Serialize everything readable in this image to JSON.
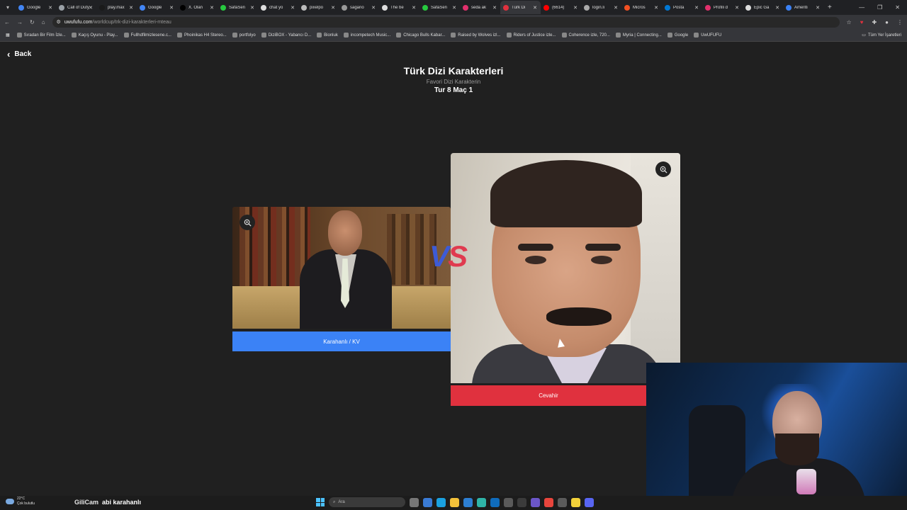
{
  "browser": {
    "tabs": [
      {
        "title": "Google",
        "color": "#4285f4"
      },
      {
        "title": "Call of Duty",
        "color": "#9aa0a6"
      },
      {
        "title": "play.max",
        "color": "#1a1a1a"
      },
      {
        "title": "Google",
        "color": "#4285f4"
      },
      {
        "title": "X. Olan",
        "color": "#000000"
      },
      {
        "title": "SafaSen",
        "color": "#27c93f"
      },
      {
        "title": "chat yo",
        "color": "#dddddd"
      },
      {
        "title": "pixelpo",
        "color": "#bbbbbb"
      },
      {
        "title": "sagano",
        "color": "#999999"
      },
      {
        "title": "The be",
        "color": "#dddddd"
      },
      {
        "title": "SafaSen",
        "color": "#27c93f"
      },
      {
        "title": "seda ak",
        "color": "#e1306c"
      },
      {
        "title": "Türk Di",
        "color": "#e0313e"
      },
      {
        "title": "(6614)",
        "color": "#ff0000"
      },
      {
        "title": "login.li",
        "color": "#aaaaaa"
      },
      {
        "title": "Micros",
        "color": "#f25022"
      },
      {
        "title": "Posta",
        "color": "#0078d4"
      },
      {
        "title": "Profili d",
        "color": "#e1306c"
      },
      {
        "title": "Epic Ga",
        "color": "#dddddd"
      },
      {
        "title": "Ameriti",
        "color": "#3b82f6"
      }
    ],
    "active_tab": 12,
    "url_host": "uwufufu.com",
    "url_path": "/worldcup/trk-dizi-karakterleri-mteau",
    "bookmarks": [
      "Sıradan Bir Film İzle...",
      "Kaçış Oyunu - Play...",
      "Fullhdfilmizlesene.c...",
      "Phoinikas H4 Stereo...",
      "portfolyo",
      "DiziBOX - Yabancı D...",
      "Bionluk",
      "incompetech Music...",
      "Chicago Bulls Kabar...",
      "Raised by Wolves izl...",
      "Riders of Justice izle...",
      "Coherence izle, 720...",
      "Myria | Connecting...",
      "Google",
      "UwUFUFU"
    ],
    "bookmarks_right": "Tüm Yer İşaretleri"
  },
  "page": {
    "back_label": "Back",
    "title": "Türk Dizi Karakterleri",
    "subtitle": "Favori Dizi Karakterin",
    "round": "Tur 8 Maç 1",
    "vs_v": "V",
    "vs_s": "S",
    "left_choice": "Karahanlı / KV",
    "right_choice": "Cevahir"
  },
  "taskbar": {
    "temp": "22°C",
    "weather": "Çok bulutlu",
    "search_placeholder": "Ara",
    "overlay_brand": "GiliCam",
    "overlay_text": "abi karahanlı"
  }
}
